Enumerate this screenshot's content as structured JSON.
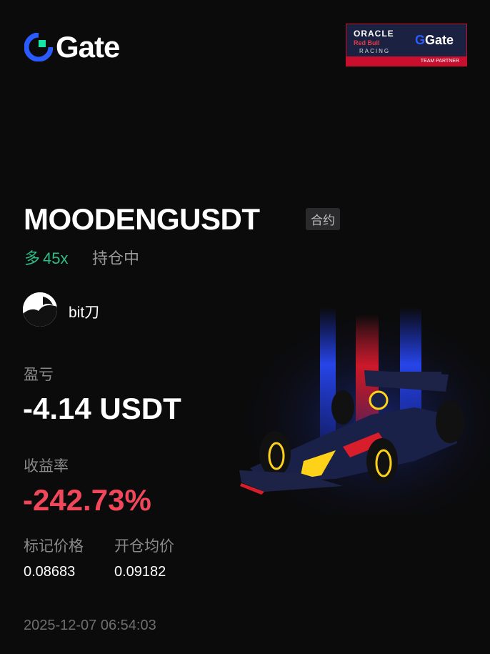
{
  "brand": {
    "name": "Gate"
  },
  "partner": {
    "oracle": "ORACLE",
    "redbull": "Red Bull",
    "racing": "RACING",
    "gate": "Gate",
    "strip": "TEAM PARTNER"
  },
  "position": {
    "symbol": "MOODENGUSDT",
    "type_tag": "合约",
    "side": "多",
    "leverage": "45x",
    "status": "持仓中"
  },
  "user": {
    "name": "bit刀"
  },
  "pnl": {
    "label": "盈亏",
    "value": "-4.14 USDT"
  },
  "roi": {
    "label": "收益率",
    "value": "-242.73%"
  },
  "prices": {
    "mark_label": "标记价格",
    "mark_value": "0.08683",
    "entry_label": "开仓均价",
    "entry_value": "0.09182"
  },
  "timestamp": "2025-12-07 06:54:03",
  "colors": {
    "long": "#2dbd85",
    "loss": "#f0475a",
    "brand": "#2a5bff"
  },
  "icons": {
    "logo": "gate-logo-icon",
    "avatar": "user-avatar",
    "car": "f1-car-illustration"
  }
}
